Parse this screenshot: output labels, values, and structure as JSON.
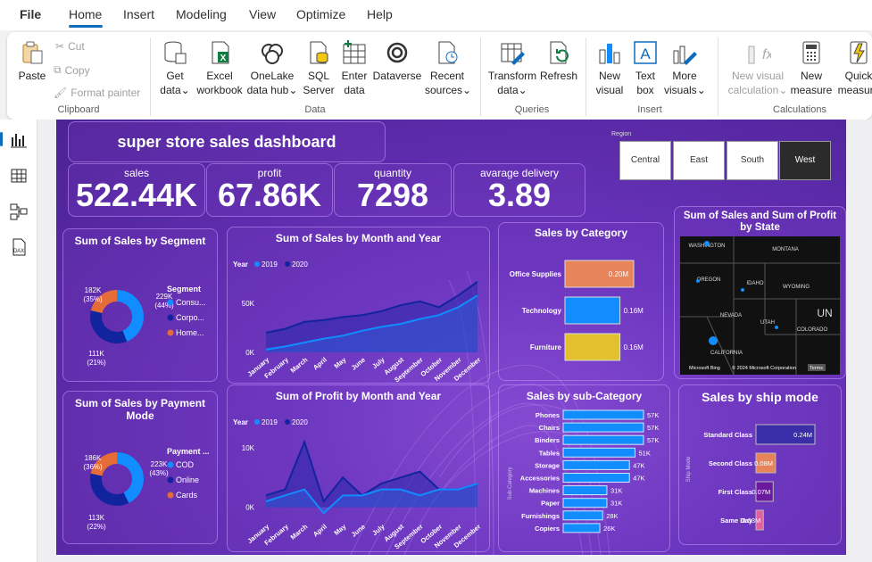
{
  "menu": {
    "file": "File",
    "tabs": [
      "Home",
      "Insert",
      "Modeling",
      "View",
      "Optimize",
      "Help"
    ]
  },
  "ribbon": {
    "clipboard": {
      "paste": "Paste",
      "cut": "Cut",
      "copy": "Copy",
      "format_painter": "Format painter",
      "group": "Clipboard"
    },
    "data": {
      "get_data": [
        "Get",
        "data"
      ],
      "excel": [
        "Excel",
        "workbook"
      ],
      "onelake": [
        "OneLake",
        "data hub"
      ],
      "sql": [
        "SQL",
        "Server"
      ],
      "enter": [
        "Enter",
        "data"
      ],
      "dataverse": "Dataverse",
      "recent": [
        "Recent",
        "sources"
      ],
      "group": "Data"
    },
    "queries": {
      "transform": [
        "Transform",
        "data"
      ],
      "refresh": "Refresh",
      "group": "Queries"
    },
    "insert": {
      "new_visual": [
        "New",
        "visual"
      ],
      "text_box": [
        "Text",
        "box"
      ],
      "more_visuals": [
        "More",
        "visuals"
      ],
      "group": "Insert"
    },
    "calculations": {
      "new_visual_calc": [
        "New visual",
        "calculation"
      ],
      "new_measure": [
        "New",
        "measure"
      ],
      "quick_measure": [
        "Quick",
        "measure"
      ],
      "group": "Calculations"
    }
  },
  "dashboard": {
    "title": "super store sales dashboard",
    "kpis": [
      {
        "label": "sales",
        "value": "522.44K"
      },
      {
        "label": "profit",
        "value": "67.86K"
      },
      {
        "label": "quantity",
        "value": "7298"
      },
      {
        "label": "avarage delivery",
        "value": "3.89"
      }
    ],
    "region": {
      "label": "Region",
      "options": [
        "Central",
        "East",
        "South",
        "West"
      ],
      "selected": "West"
    }
  },
  "colors": {
    "segment": [
      "#118dff",
      "#12239e",
      "#e66c37"
    ]
  },
  "chart_data": [
    {
      "type": "pie",
      "title": "Sum of Sales by Segment",
      "legend_title": "Segment",
      "labels": [
        "Consu...",
        "Corpo...",
        "Home..."
      ],
      "values": [
        229,
        182,
        111
      ],
      "data_labels": [
        "229K (44%)",
        "182K (35%)",
        "111K (21%)"
      ]
    },
    {
      "type": "area",
      "title": "Sum of Sales by Month and Year",
      "legend_title": "Year",
      "categories": [
        "January",
        "February",
        "March",
        "April",
        "May",
        "June",
        "July",
        "August",
        "September",
        "October",
        "November",
        "December"
      ],
      "series": [
        {
          "name": "2019",
          "values": [
            3,
            6,
            10,
            14,
            17,
            22,
            26,
            29,
            34,
            38,
            46,
            58
          ]
        },
        {
          "name": "2020",
          "values": [
            20,
            24,
            31,
            33,
            36,
            38,
            42,
            48,
            52,
            46,
            58,
            72
          ]
        }
      ],
      "yticks": [
        "0K",
        "50K"
      ],
      "ylim": [
        0,
        80
      ]
    },
    {
      "type": "bar",
      "title": "Sales by Category",
      "categories": [
        "Office Supplies",
        "Technology",
        "Furniture"
      ],
      "values": [
        0.2,
        0.16,
        0.16
      ],
      "data_labels": [
        "0.20M",
        "0.16M",
        "0.16M"
      ]
    },
    {
      "type": "map",
      "title": "Sum of Sales and Sum of Profit by State",
      "labels": [
        "WASHINGTON",
        "MONTANA",
        "OREGON",
        "IDAHO",
        "WYOMING",
        "NEVADA",
        "UTAH",
        "COLORADO",
        "CALIFORNIA",
        "UN"
      ],
      "attribution": [
        "Microsoft Bing",
        "© 2024 Microsoft Corporation",
        "Terms"
      ]
    },
    {
      "type": "pie",
      "title": "Sum of Sales by Payment Mode",
      "legend_title": "Payment ...",
      "labels": [
        "COD",
        "Online",
        "Cards"
      ],
      "values": [
        223,
        186,
        113
      ],
      "data_labels": [
        "223K (43%)",
        "186K (36%)",
        "113K (22%)"
      ]
    },
    {
      "type": "area",
      "title": "Sum of Profit by Month and Year",
      "legend_title": "Year",
      "categories": [
        "January",
        "February",
        "March",
        "April",
        "May",
        "June",
        "July",
        "August",
        "September",
        "October",
        "November",
        "December"
      ],
      "series": [
        {
          "name": "2019",
          "values": [
            1,
            2,
            3,
            -1,
            2,
            2,
            3,
            3,
            2,
            3,
            3,
            4
          ]
        },
        {
          "name": "2020",
          "values": [
            2,
            3,
            11,
            1,
            5,
            2,
            4,
            5,
            6,
            3,
            3,
            4
          ]
        }
      ],
      "yticks": [
        "0K",
        "10K"
      ],
      "ylim": [
        -2,
        13
      ]
    },
    {
      "type": "bar",
      "title": "Sales by sub-Category",
      "yaxis_label": "Sub-Category",
      "categories": [
        "Phones",
        "Chairs",
        "Binders",
        "Tables",
        "Storage",
        "Accessories",
        "Machines",
        "Paper",
        "Furnishings",
        "Copiers"
      ],
      "values": [
        57,
        57,
        57,
        51,
        47,
        47,
        31,
        31,
        28,
        26
      ],
      "data_labels": [
        "57K",
        "57K",
        "57K",
        "51K",
        "47K",
        "47K",
        "31K",
        "31K",
        "28K",
        "26K"
      ]
    },
    {
      "type": "bar",
      "title": "Sales by ship mode",
      "yaxis_label": "Ship Mode",
      "categories": [
        "Standard Class",
        "Second Class",
        "First Class",
        "Same Day"
      ],
      "values": [
        0.24,
        0.08,
        0.07,
        0.03
      ],
      "data_labels": [
        "0.24M",
        "0.08M",
        "0.07M",
        "0.03M"
      ]
    }
  ]
}
